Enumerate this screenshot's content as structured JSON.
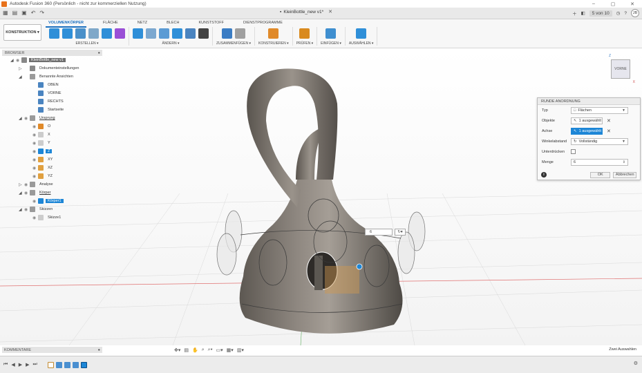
{
  "app": {
    "title": "Autodesk Fusion 360 (Persönlich - nicht zur kommerziellen Nutzung)"
  },
  "window_controls": {
    "minimize": "–",
    "maximize": "▢",
    "close": "✕"
  },
  "document_tab": {
    "title": "KleinBottle_new v1*",
    "close": "✕"
  },
  "topbar_right": {
    "count": "5 von 10",
    "user_initials": "JB"
  },
  "workspace": {
    "label": "KONSTRUKTION ▾"
  },
  "tabs": [
    {
      "label": "VOLUMENKÖRPER"
    },
    {
      "label": "FLÄCHE"
    },
    {
      "label": "NETZ"
    },
    {
      "label": "BLECH"
    },
    {
      "label": "KUNSTSTOFF"
    },
    {
      "label": "DIENSTPROGRAMME"
    }
  ],
  "tool_groups": [
    {
      "label": "ERSTELLEN ▾",
      "colors": [
        "#2f8fd8",
        "#2f8fd8",
        "#4a90c9",
        "#7fa8c9",
        "#2f8fd8",
        "#9a4fd6"
      ]
    },
    {
      "label": "ÄNDERN ▾",
      "colors": [
        "#2f8fd8",
        "#7ca8d0",
        "#5b9bd4",
        "#2f8fd8",
        "#4a84c0",
        "#444444"
      ]
    },
    {
      "label": "ZUSAMMENFÜGEN ▾",
      "colors": [
        "#3b7dc4",
        "#a0a0a0"
      ]
    },
    {
      "label": "KONSTRUIEREN ▾",
      "colors": [
        "#e08a2a"
      ]
    },
    {
      "label": "PRÜFEN ▾",
      "colors": [
        "#d98a1e"
      ]
    },
    {
      "label": "EINFÜGEN ▾",
      "colors": [
        "#3f8fd0"
      ]
    },
    {
      "label": "AUSWÄHLEN ▾",
      "colors": [
        "#2f8fd8"
      ]
    }
  ],
  "browser": {
    "title": "BROWSER",
    "items": [
      {
        "label": "KleinBottle_new v1",
        "depth": 0,
        "caret": "◢",
        "eye": true,
        "color": "#888888",
        "style": "root"
      },
      {
        "label": "Dokumenteinstellungen",
        "depth": 1,
        "caret": "▷",
        "eye": false,
        "color": "#888888",
        "style": ""
      },
      {
        "label": "Benannte Ansichten",
        "depth": 1,
        "caret": "◢",
        "eye": false,
        "color": "#9a9a9a",
        "style": ""
      },
      {
        "label": "OBEN",
        "depth": 2,
        "caret": "",
        "eye": false,
        "color": "#4a84c0",
        "style": ""
      },
      {
        "label": "VORNE",
        "depth": 2,
        "caret": "",
        "eye": false,
        "color": "#4a84c0",
        "style": ""
      },
      {
        "label": "RECHTS",
        "depth": 2,
        "caret": "",
        "eye": false,
        "color": "#4a84c0",
        "style": ""
      },
      {
        "label": "Startseite",
        "depth": 2,
        "caret": "",
        "eye": false,
        "color": "#4a84c0",
        "style": ""
      },
      {
        "label": "Ursprung",
        "depth": 1,
        "caret": "◢",
        "eye": true,
        "color": "#9a9a9a",
        "style": "ul"
      },
      {
        "label": "O",
        "depth": 2,
        "caret": "",
        "eye": true,
        "color": "#e08a2a",
        "style": ""
      },
      {
        "label": "X",
        "depth": 2,
        "caret": "",
        "eye": true,
        "color": "#cccccc",
        "style": ""
      },
      {
        "label": "Y",
        "depth": 2,
        "caret": "",
        "eye": true,
        "color": "#cccccc",
        "style": ""
      },
      {
        "label": "Z",
        "depth": 2,
        "caret": "",
        "eye": true,
        "color": "#1d86d6",
        "style": "sel"
      },
      {
        "label": "XY",
        "depth": 2,
        "caret": "",
        "eye": true,
        "color": "#e0a040",
        "style": ""
      },
      {
        "label": "XZ",
        "depth": 2,
        "caret": "",
        "eye": true,
        "color": "#e0a040",
        "style": ""
      },
      {
        "label": "YZ",
        "depth": 2,
        "caret": "",
        "eye": true,
        "color": "#e0a040",
        "style": ""
      },
      {
        "label": "Analyse",
        "depth": 1,
        "caret": "▷",
        "eye": true,
        "color": "#9a9a9a",
        "style": ""
      },
      {
        "label": "Körper",
        "depth": 1,
        "caret": "◢",
        "eye": true,
        "color": "#9a9a9a",
        "style": "ul"
      },
      {
        "label": "Körper1",
        "depth": 2,
        "caret": "",
        "eye": true,
        "color": "#1d86d6",
        "style": "sel"
      },
      {
        "label": "Skizzen",
        "depth": 1,
        "caret": "◢",
        "eye": true,
        "color": "#9a9a9a",
        "style": ""
      },
      {
        "label": "Skizze1",
        "depth": 2,
        "caret": "",
        "eye": true,
        "color": "#cccccc",
        "style": ""
      }
    ]
  },
  "comments": {
    "label": "KOMMENTARE"
  },
  "viewcube": {
    "face": "VORNE",
    "axis_z": "Z",
    "axis_x": "X"
  },
  "dialog": {
    "title": "RUNDE ANORDNUNG",
    "typ_label": "Typ",
    "typ_value": "Flächen",
    "objekte_label": "Objekte",
    "objekte_value": "1 ausgewählt",
    "achse_label": "Achse",
    "achse_value": "1 ausgewählt",
    "winkel_label": "Winkelabstand",
    "winkel_value": "Vollständig",
    "unterdruecken_label": "Unterdrücken",
    "menge_label": "Menge",
    "menge_value": "6",
    "ok": "OK",
    "cancel": "Abbrechen",
    "info": "i"
  },
  "float_input": {
    "value": "6"
  },
  "status": {
    "label": "Zwei Auswahlen"
  },
  "accent": "#1d86d6",
  "body_color": "#7a746c"
}
